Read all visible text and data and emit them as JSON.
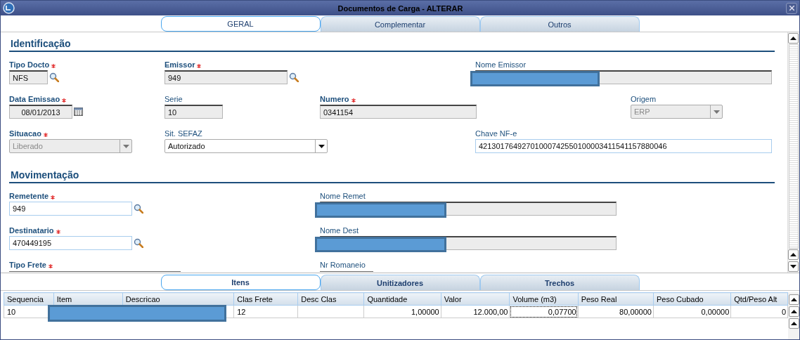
{
  "window": {
    "title": "Documentos de Carga - ALTERAR"
  },
  "tabs": [
    {
      "label": "GERAL",
      "selected": true
    },
    {
      "label": "Complementar",
      "selected": false
    },
    {
      "label": "Outros",
      "selected": false
    }
  ],
  "sections": [
    {
      "title": "Identificação",
      "rows": [
        [
          {
            "label": "Tipo Docto",
            "required": true,
            "kind": "lookup",
            "value": "NFS",
            "readonly": true
          },
          {
            "label": "Emissor",
            "required": true,
            "kind": "lookup",
            "value": "949",
            "readonly": true
          },
          {
            "label": "Nome Emissor",
            "required": false,
            "kind": "text",
            "readonly": true,
            "redacted": true
          }
        ],
        [
          {
            "label": "Data Emissao",
            "required": true,
            "kind": "date",
            "value": "08/01/2013",
            "readonly": true
          },
          {
            "label": "Serie",
            "required": false,
            "kind": "text",
            "value": "10",
            "readonly": true
          },
          {
            "label": "Numero",
            "required": true,
            "kind": "text",
            "value": "0341154",
            "readonly": true
          },
          {
            "label": "Origem",
            "required": false,
            "kind": "select",
            "value": "ERP",
            "disabled": true
          }
        ],
        [
          {
            "label": "Situacao",
            "required": true,
            "kind": "select",
            "value": "Liberado",
            "disabled": true
          },
          {
            "label": "Sit. SEFAZ",
            "required": false,
            "kind": "select",
            "value": "Autorizado",
            "disabled": false
          },
          {
            "label": "Chave NF-e",
            "required": false,
            "kind": "text",
            "value": "42130176492701000742550100003411541157880046",
            "readonly": false
          }
        ]
      ]
    },
    {
      "title": "Movimentação",
      "rows": [
        [
          {
            "label": "Remetente",
            "required": true,
            "kind": "lookup",
            "value": "949",
            "readonly": false
          },
          {
            "label": "Nome Remet",
            "required": false,
            "kind": "text",
            "readonly": true,
            "redacted": true
          }
        ],
        [
          {
            "label": "Destinatario",
            "required": true,
            "kind": "lookup",
            "value": "470449195",
            "readonly": false
          },
          {
            "label": "Nome Dest",
            "required": false,
            "kind": "text",
            "readonly": true,
            "redacted": true
          }
        ],
        [
          {
            "label": "Tipo Frete",
            "required": true,
            "kind": "cut"
          },
          {
            "label": "Nr Romaneio",
            "required": false,
            "kind": "cut"
          }
        ]
      ]
    }
  ],
  "bottom_tabs": [
    {
      "label": "Itens",
      "selected": true
    },
    {
      "label": "Unitizadores",
      "selected": false
    },
    {
      "label": "Trechos",
      "selected": false
    }
  ],
  "table": {
    "columns": [
      "Sequencia",
      "Item",
      "Descricao",
      "Clas Frete",
      "Desc Clas",
      "Quantidade",
      "Valor",
      "Volume (m3)",
      "Peso Real",
      "Peso Cubado",
      "Qtd/Peso Alt"
    ],
    "rows": [
      {
        "cells": [
          {
            "text": "10",
            "focused": false
          },
          {
            "redacted": true
          },
          {
            "redacted": true
          },
          {
            "text": "12",
            "focused": false
          },
          {
            "focused": false
          },
          {
            "text": "1,00000",
            "focused": false
          },
          {
            "text": "12.000,00",
            "focused": false
          },
          {
            "text": "0,07700",
            "focused": true
          },
          {
            "text": "80,00000",
            "focused": false
          },
          {
            "text": "0,00000",
            "focused": false
          },
          {
            "text": "0",
            "focused": false
          }
        ]
      }
    ]
  }
}
